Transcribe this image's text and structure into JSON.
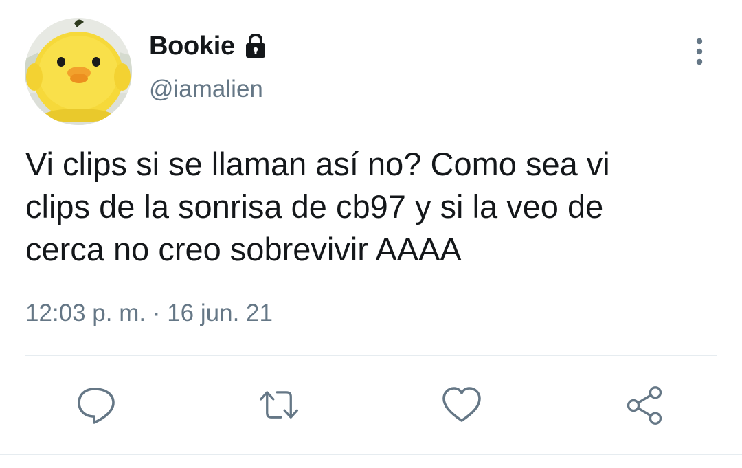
{
  "user": {
    "display_name": "Bookie",
    "handle": "@iamalien",
    "avatar_icon": "yellow-chick-plush-avatar",
    "protected_icon": "lock-icon"
  },
  "tweet": {
    "text": "Vi clips si se llaman así no? Como sea vi\nclips de la sonrisa de cb97 y si la veo de\ncerca no creo sobrevivir AAAA",
    "timestamp": "12:03 p. m. · 16 jun. 21"
  },
  "actions": {
    "reply_icon": "reply-icon",
    "retweet_icon": "retweet-icon",
    "like_icon": "heart-icon",
    "share_icon": "share-icon",
    "more_icon": "more-vertical-icon"
  },
  "colors": {
    "text": "#14171a",
    "secondary": "#657786",
    "divider": "#e6ecf0",
    "icon": "#657786"
  }
}
